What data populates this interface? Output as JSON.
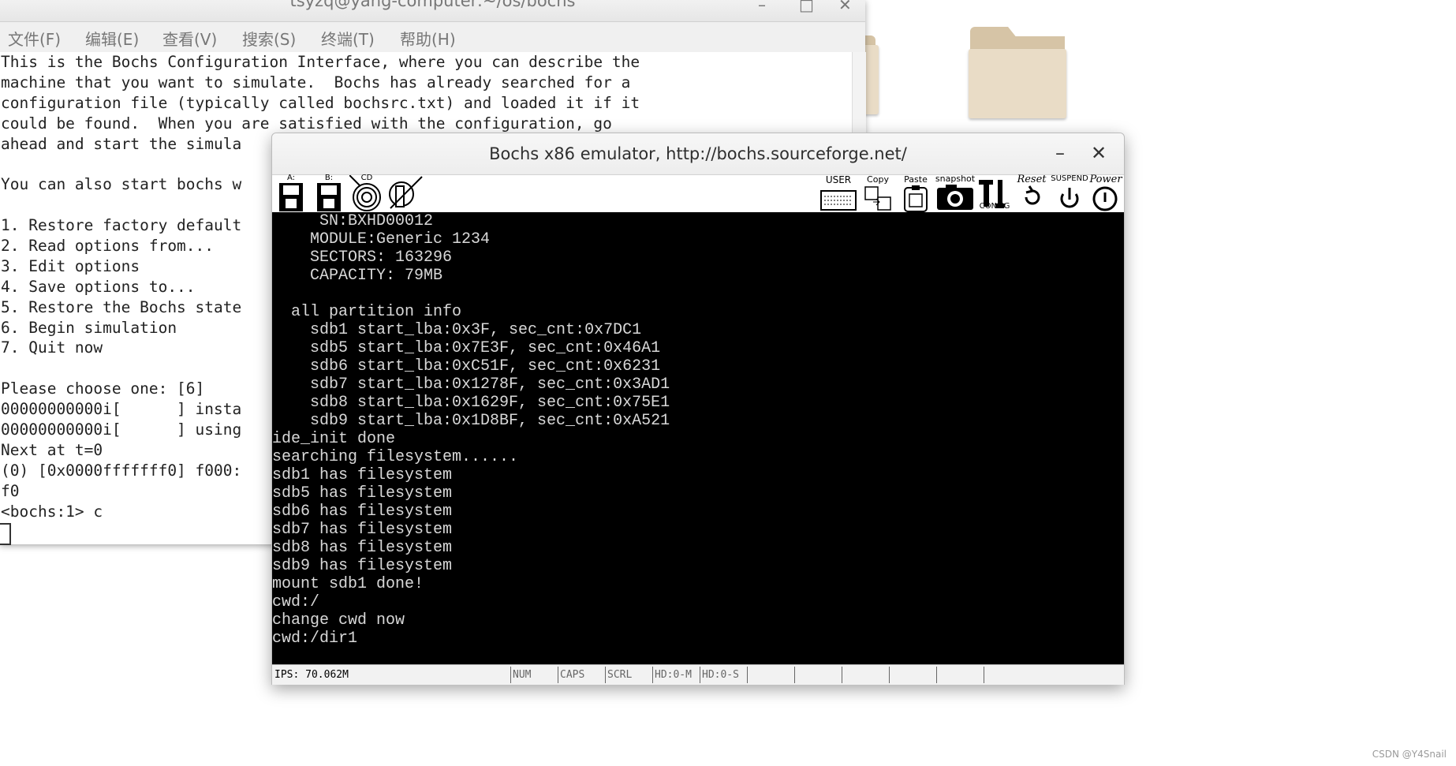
{
  "terminal": {
    "title": "tsyzq@yang-computer:~/os/bochs",
    "menu": [
      "文件(F)",
      "编辑(E)",
      "查看(V)",
      "搜索(S)",
      "终端(T)",
      "帮助(H)"
    ],
    "lines": [
      "This is the Bochs Configuration Interface, where you can describe the",
      "machine that you want to simulate.  Bochs has already searched for a",
      "configuration file (typically called bochsrc.txt) and loaded it if it",
      "could be found.  When you are satisfied with the configuration, go",
      "ahead and start the simula",
      "",
      "You can also start bochs w",
      "",
      "1. Restore factory default",
      "2. Read options from...",
      "3. Edit options",
      "4. Save options to...",
      "5. Restore the Bochs state",
      "6. Begin simulation",
      "7. Quit now",
      "",
      "Please choose one: [6]",
      "00000000000i[      ] insta",
      "00000000000i[      ] using",
      "Next at t=0",
      "(0) [0x0000fffffff0] f000:",
      "f0",
      "<bochs:1> c"
    ]
  },
  "bochs": {
    "title": "Bochs x86 emulator, http://bochs.sourceforge.net/",
    "minimize": "–",
    "close": "✕",
    "toolbar": {
      "a_label": "A:",
      "b_label": "B:",
      "cd_label": "CD",
      "user_label": "USER",
      "copy_label": "Copy",
      "paste_label": "Paste",
      "snapshot_label": "snapshot",
      "config_label": "CONFIG",
      "reset_label": "Reset",
      "suspend_label": "SUSPEND",
      "power_label": "Power"
    },
    "screen_lines": [
      "     SN:BXHD00012",
      "    MODULE:Generic 1234",
      "    SECTORS: 163296",
      "    CAPACITY: 79MB",
      "",
      "  all partition info",
      "    sdb1 start_lba:0x3F, sec_cnt:0x7DC1",
      "    sdb5 start_lba:0x7E3F, sec_cnt:0x46A1",
      "    sdb6 start_lba:0xC51F, sec_cnt:0x6231",
      "    sdb7 start_lba:0x1278F, sec_cnt:0x3AD1",
      "    sdb8 start_lba:0x1629F, sec_cnt:0x75E1",
      "    sdb9 start_lba:0x1D8BF, sec_cnt:0xA521",
      "ide_init done",
      "searching filesystem......",
      "sdb1 has filesystem",
      "sdb5 has filesystem",
      "sdb6 has filesystem",
      "sdb7 has filesystem",
      "sdb8 has filesystem",
      "sdb9 has filesystem",
      "mount sdb1 done!",
      "cwd:/",
      "change cwd now",
      "cwd:/dir1"
    ],
    "status": {
      "ips": "IPS: 70.062M",
      "num": "NUM",
      "caps": "CAPS",
      "scrl": "SCRL",
      "hd0m": "HD:0-M",
      "hd0s": "HD:0-S"
    }
  },
  "watermark": "CSDN @Y4Snail"
}
